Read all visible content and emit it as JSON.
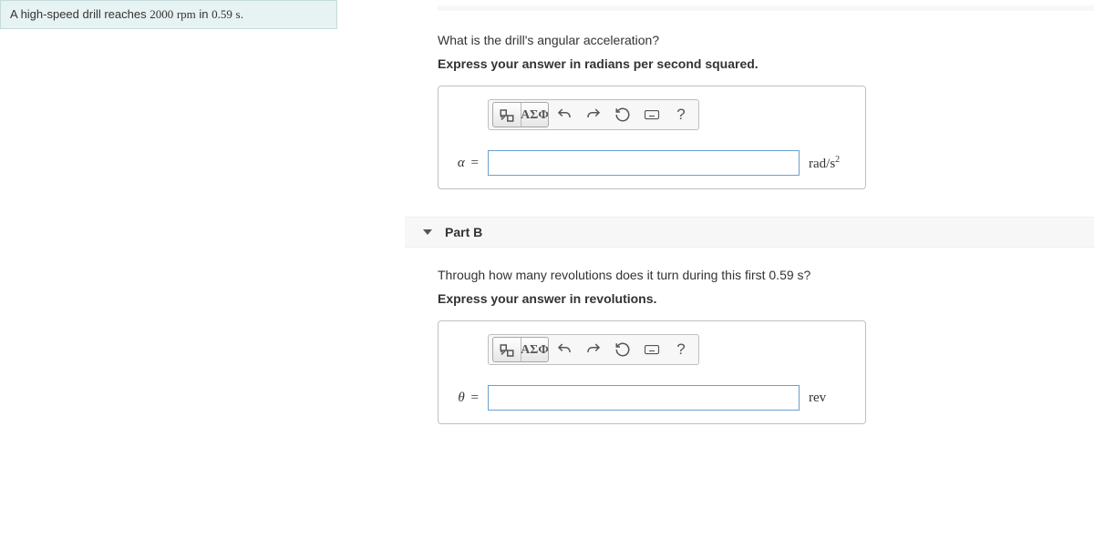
{
  "problem": {
    "prefix": "A high-speed drill reaches ",
    "rpm_value": "2000",
    "rpm_unit": "rpm",
    "middle": " in ",
    "time_value": "0.59",
    "time_unit": "s",
    "suffix": "."
  },
  "partA": {
    "question": "What is the drill's angular acceleration?",
    "hint": "Express your answer in radians per second squared.",
    "var": "α",
    "units_html": "rad/s²",
    "units_plain": "rad/s",
    "units_sup": "2"
  },
  "partB": {
    "title": "Part B",
    "question": "Through how many revolutions does it turn during this first 0.59 s?",
    "hint": "Express your answer in revolutions.",
    "var": "θ",
    "units": "rev"
  },
  "toolbar": {
    "greek": "ΑΣΦ",
    "help": "?"
  }
}
